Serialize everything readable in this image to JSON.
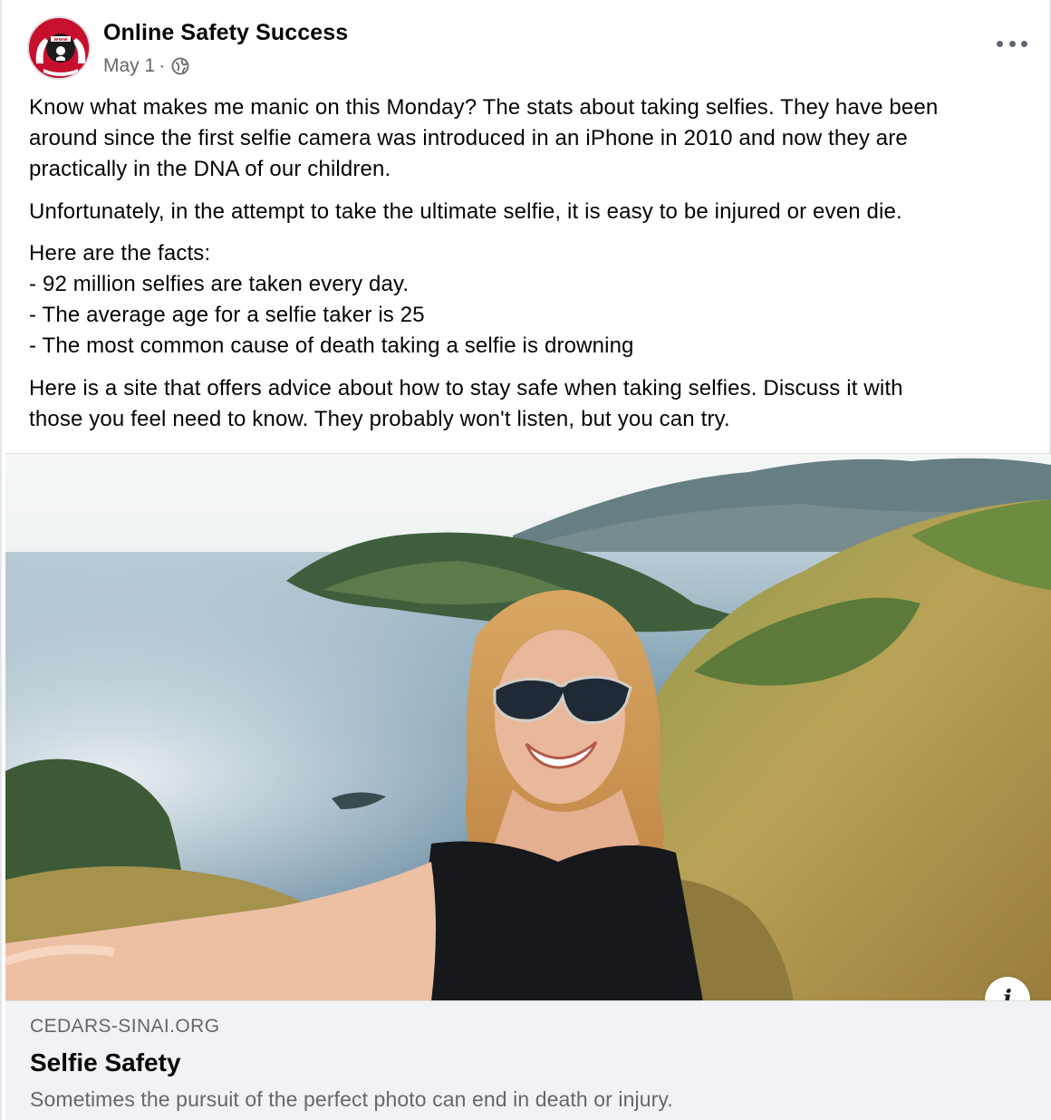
{
  "post": {
    "page_name": "Online Safety Success",
    "date": "May 1",
    "separator": "·",
    "privacy_icon": "globe-icon",
    "more_icon": "more-horizontal-icon",
    "avatar_icon": "online-safety-logo",
    "avatar_text": "www",
    "paragraphs": [
      [
        "Know what makes me manic on this Monday? The stats about taking selfies. They have been",
        "around since the first selfie camera was introduced in an iPhone in 2010 and now they are",
        "practically in the DNA of our children."
      ],
      [
        "Unfortunately, in the attempt to take the ultimate selfie, it is easy to be injured or even die."
      ],
      [
        "Here are the facts:",
        "- 92 million selfies are taken every day.",
        "- The average age for a selfie taker is 25",
        "- The most common cause of death taking a selfie is drowning"
      ],
      [
        "Here is a site that offers advice about how to stay safe when taking selfies. Discuss it with",
        "those you feel need to know. They probably won't listen, but you can try."
      ]
    ]
  },
  "link_preview": {
    "domain": "CEDARS-SINAI.ORG",
    "title": "Selfie Safety",
    "description": "Sometimes the pursuit of the perfect photo can end in death or injury.",
    "info_label": "i",
    "image_alt": "woman-taking-selfie-on-coastal-hill"
  },
  "colors": {
    "brand_red": "#c8102e",
    "secondary_text": "#65676b",
    "preview_bg": "#f0f2f5"
  }
}
